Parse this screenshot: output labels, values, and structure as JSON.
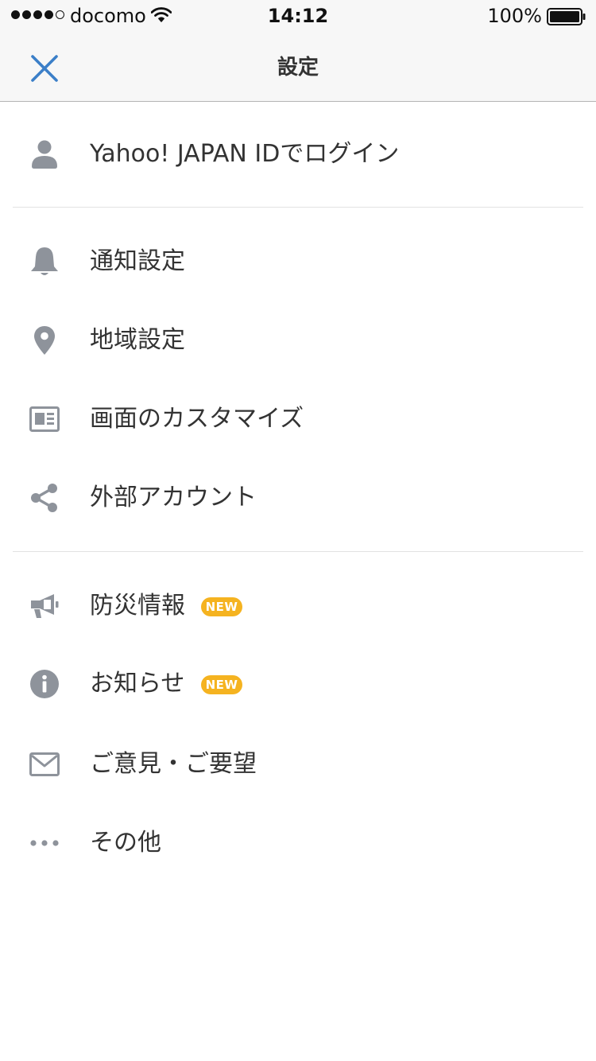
{
  "status_bar": {
    "carrier": "docomo",
    "time": "14:12",
    "battery": "100%"
  },
  "nav": {
    "title": "設定"
  },
  "menu": {
    "login": {
      "label": "Yahoo! JAPAN IDでログイン",
      "icon": "person-icon"
    },
    "notification": {
      "label": "通知設定",
      "icon": "bell-icon"
    },
    "region": {
      "label": "地域設定",
      "icon": "map-pin-icon"
    },
    "customize": {
      "label": "画面のカスタマイズ",
      "icon": "newspaper-icon"
    },
    "external": {
      "label": "外部アカウント",
      "icon": "share-icon"
    },
    "disaster": {
      "label": "防災情報",
      "badge": "NEW",
      "icon": "megaphone-icon"
    },
    "news": {
      "label": "お知らせ",
      "badge": "NEW",
      "icon": "info-icon"
    },
    "feedback": {
      "label": "ご意見・ご要望",
      "icon": "envelope-icon"
    },
    "other": {
      "label": "その他",
      "icon": "more-dots-icon"
    }
  },
  "colors": {
    "accent": "#3b7fc8",
    "icon_gray": "#8e939b",
    "badge": "#f5b320",
    "bar_background": "#f7f7f7"
  }
}
